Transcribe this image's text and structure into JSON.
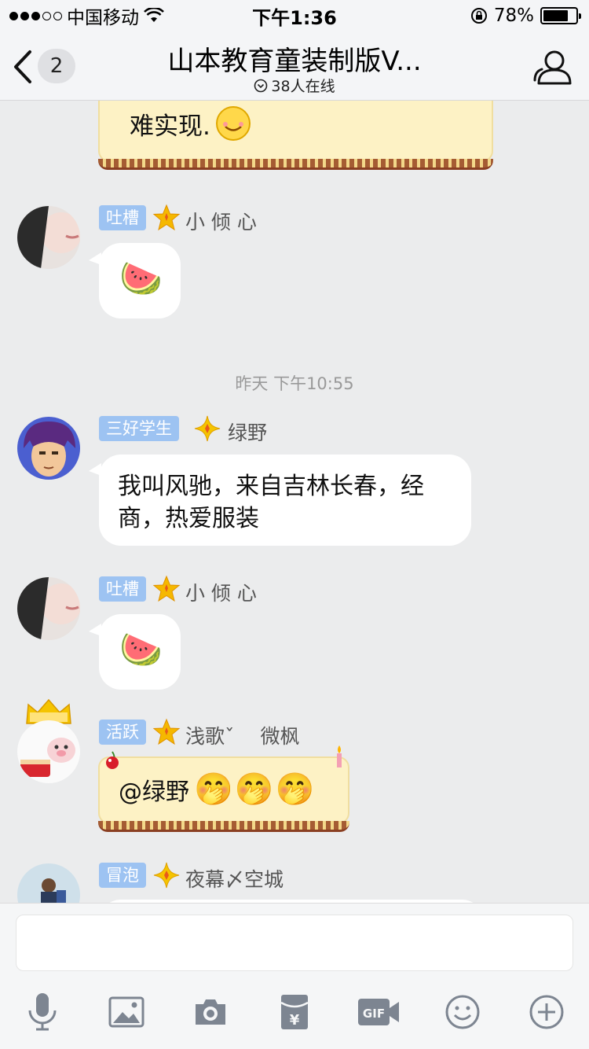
{
  "status_bar": {
    "carrier": "中国移动",
    "time": "下午1:36",
    "battery_percent": "78%",
    "battery_level": 0.78
  },
  "nav": {
    "unread_count": "2",
    "title": "山本教育童装制版V...",
    "online_count": "38人在线"
  },
  "messages": {
    "first_tail_text": "难实现.",
    "m1": {
      "tag": "吐槽",
      "nick": "小 倾 心",
      "emoji": "🍉"
    },
    "timestamp": "昨天 下午10:55",
    "m2": {
      "tag": "三好学生",
      "nick": "绿野",
      "text_line1": "我叫风驰，来自吉林长春，经",
      "text_line2": "商，热爱服装"
    },
    "m3": {
      "tag": "吐槽",
      "nick": "小 倾 心",
      "emoji": "🍉"
    },
    "m4": {
      "tag": "活跃",
      "nick": "浅歌ˇ 　微枫",
      "mention": "@绿野",
      "emojis": "🤭🤭🤭"
    },
    "m5": {
      "tag": "冒泡",
      "nick": "夜幕〆空城"
    }
  },
  "input": {
    "value": "",
    "placeholder": ""
  },
  "toolbar": {
    "icons": [
      "microphone-icon",
      "image-icon",
      "camera-icon",
      "red-packet-icon",
      "gif-icon",
      "emoji-icon",
      "plus-icon"
    ]
  },
  "colors": {
    "tag_blue": "#9dc3f2",
    "chat_bg": "#ebeced",
    "fancy_bubble": "#fdf2c5",
    "star_gold": "#f5b800"
  }
}
